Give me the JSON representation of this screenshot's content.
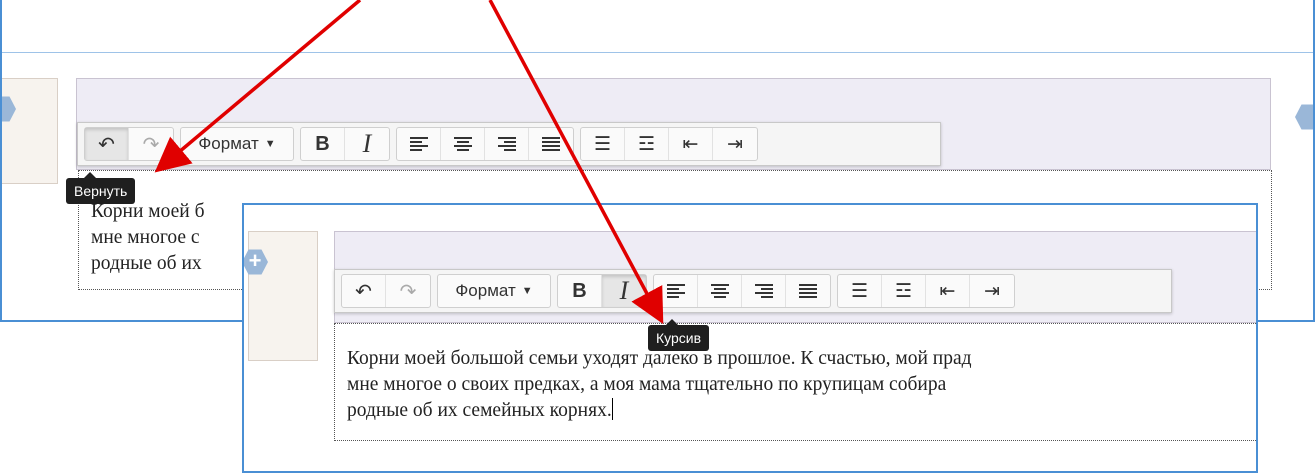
{
  "toolbar": {
    "undo_icon": "undo-icon",
    "redo_icon": "redo-icon",
    "format_label": "Формат",
    "bold_label": "B",
    "italic_label": "I",
    "align_left_icon": "align-left-icon",
    "align_center_icon": "align-center-icon",
    "align_right_icon": "align-right-icon",
    "align_justify_icon": "align-justify-icon",
    "bullet_list_icon": "bullet-list-icon",
    "numbered_list_icon": "numbered-list-icon",
    "outdent_icon": "outdent-icon",
    "indent_icon": "indent-icon"
  },
  "tooltips": {
    "undo": "Вернуть",
    "italic": "Курсив"
  },
  "editor_back": {
    "line1": "Корни моей б",
    "line2": "мне многое с",
    "line3": "родные об их"
  },
  "editor_front": {
    "line1": "Корни моей большой семьи уходят далеко в прошлое. К счастью, мой прад",
    "line2": "мне многое о своих предках, а моя мама тщательно по крупицам собира",
    "line3": "родные об их семейных корнях."
  },
  "annotation_color": "#e00000",
  "frame_color": "#4a8fd4"
}
